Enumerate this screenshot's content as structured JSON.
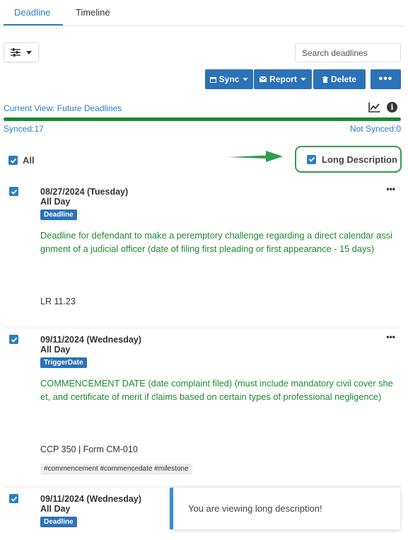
{
  "tabs": [
    {
      "label": "Deadline",
      "active": true
    },
    {
      "label": "Timeline",
      "active": false
    }
  ],
  "toolbar": {
    "filter_icon": "sliders-icon",
    "search_placeholder": "Search deadlines",
    "sync_label": "Sync",
    "report_label": "Report",
    "delete_label": "Delete",
    "more_label": "•••"
  },
  "status": {
    "current_view": "Current View: Future Deadlines",
    "synced": "Synced:17",
    "not_synced": "Not Synced:0",
    "progress_fraction": 1.0,
    "progress_color": "#1a8a2e"
  },
  "selection": {
    "all_label": "All",
    "all_checked": true,
    "long_description_label": "Long Description",
    "long_description_checked": true
  },
  "deadlines": [
    {
      "date": "08/27/2024 (Tuesday)",
      "time": "All Day",
      "badge": "Deadline",
      "description": "Deadline for defendant to make a peremptory challenge regarding a direct calendar assignment of a judicial officer (date of filing first pleading or first appearance - 15 days)",
      "rule": "LR 11.23",
      "tags": "",
      "checked": true
    },
    {
      "date": "09/11/2024 (Wednesday)",
      "time": "All Day",
      "badge": "TriggerDate",
      "description": "COMMENCEMENT DATE (date complaint filed) (must include mandatory civil cover sheet, and certificate of merit if claims based on certain types of professional negligence)",
      "rule": "CCP 350 | Form CM-010",
      "tags": "#commencement #commencedate #milestone",
      "checked": true
    },
    {
      "date": "09/11/2024 (Wednesday)",
      "time": "All Day",
      "badge": "Deadline",
      "description": "",
      "rule": "",
      "tags": "",
      "checked": true
    }
  ],
  "toast": {
    "message": "You are viewing long description!"
  },
  "colors": {
    "accent": "#2b72b8",
    "link": "#2a7fc0",
    "description_text": "#1f8a30",
    "highlight_border": "#2e9e4e"
  }
}
